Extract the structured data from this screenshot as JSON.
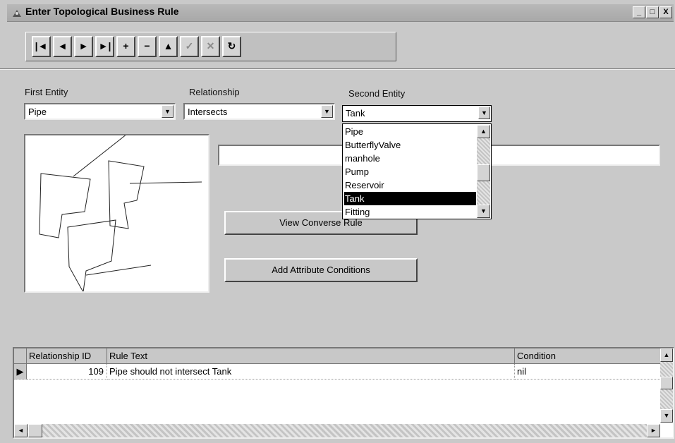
{
  "window": {
    "title": "Enter Topological Business Rule",
    "controls": [
      "_",
      "□",
      "X"
    ]
  },
  "toolbar": {
    "buttons": [
      {
        "icon": "first-record-icon",
        "glyph": "|◄"
      },
      {
        "icon": "previous-record-icon",
        "glyph": "◄"
      },
      {
        "icon": "next-record-icon",
        "glyph": "►"
      },
      {
        "icon": "last-record-icon",
        "glyph": "►|"
      },
      {
        "icon": "add-record-icon",
        "glyph": "+"
      },
      {
        "icon": "delete-record-icon",
        "glyph": "−"
      },
      {
        "icon": "edit-record-icon",
        "glyph": "▲"
      },
      {
        "icon": "post-edit-icon",
        "glyph": "✓"
      },
      {
        "icon": "cancel-edit-icon",
        "glyph": "✕"
      },
      {
        "icon": "refresh-icon",
        "glyph": "↻"
      }
    ]
  },
  "form": {
    "first_entity_label": "First Entity",
    "first_entity_value": "Pipe",
    "relationship_label": "Relationship",
    "relationship_value": "Intersects",
    "second_entity_label": "Second Entity",
    "second_entity_value": "Tank",
    "second_entity_options": [
      "Pipe",
      "ButterflyValve",
      "manhole",
      "Pump",
      "Reservoir",
      "Tank",
      "Fitting"
    ],
    "second_entity_selected": "Tank",
    "rule_text_value": "",
    "view_converse_label": "View Converse Rule",
    "add_attribute_label": "Add Attribute Conditions"
  },
  "grid": {
    "columns": [
      "Relationship ID",
      "Rule Text",
      "Condition"
    ],
    "rows": [
      {
        "id": "109",
        "rule_text": "Pipe should not intersect Tank",
        "condition": "nil"
      }
    ]
  }
}
